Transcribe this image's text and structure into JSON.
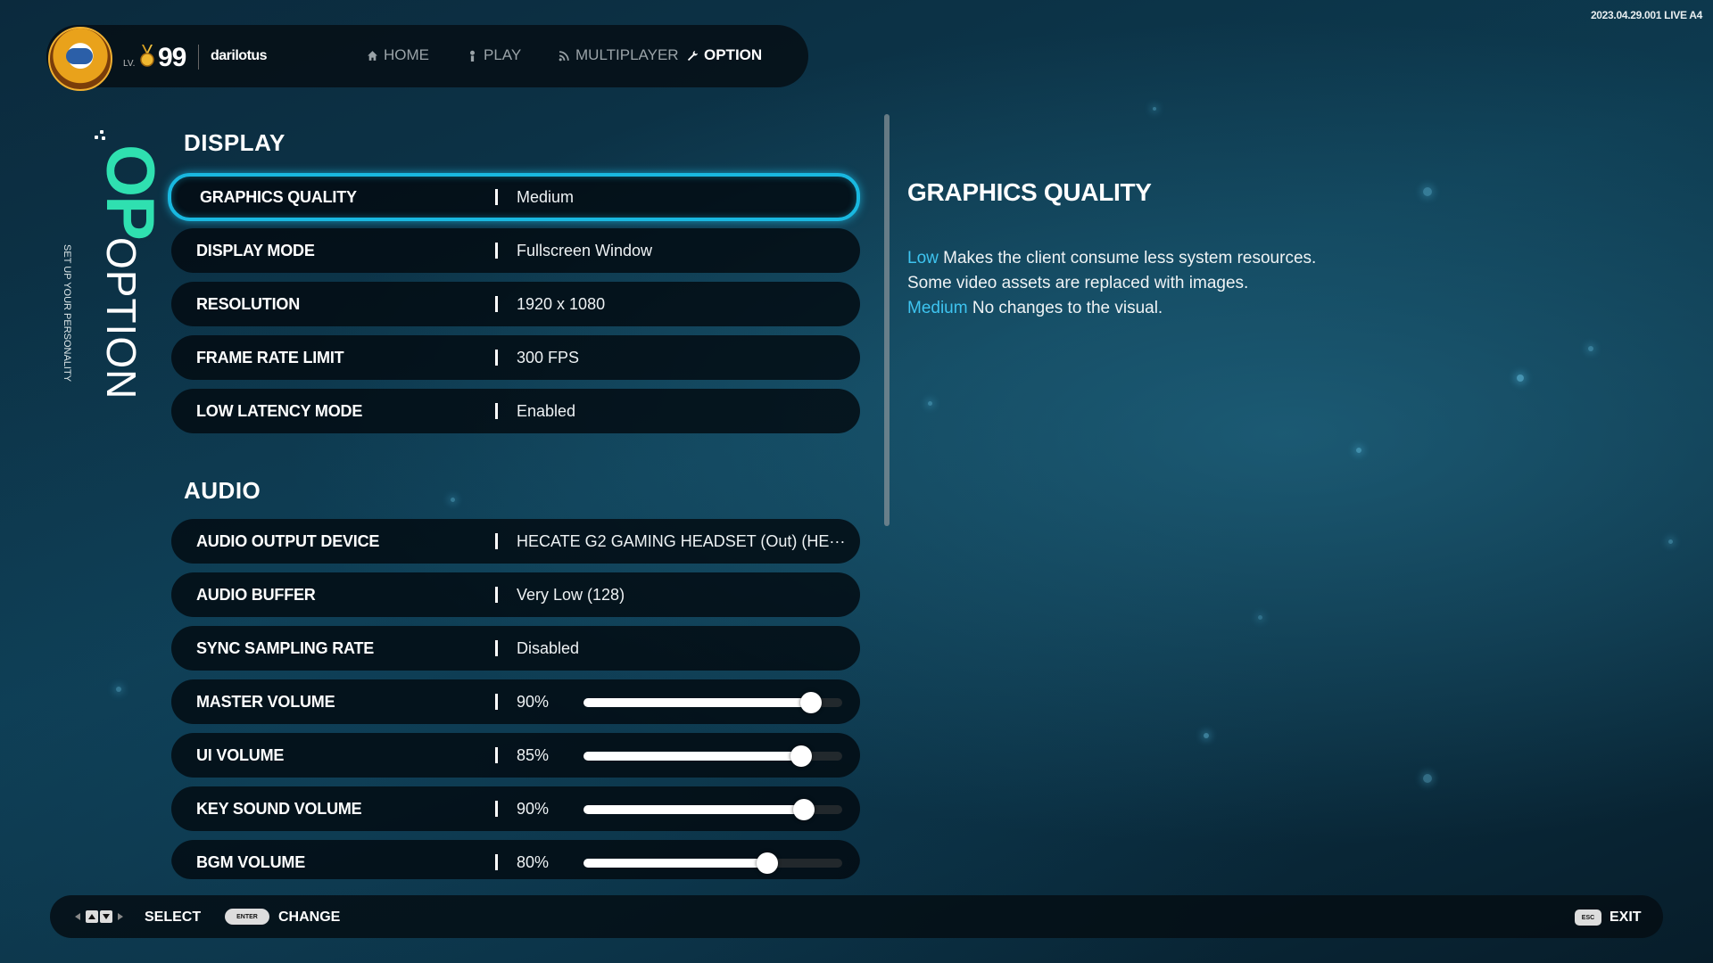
{
  "version": "2023.04.29.001 LIVE A4",
  "player": {
    "lv_label": "LV.",
    "level": "99",
    "username": "darilotus"
  },
  "nav": [
    {
      "label": "HOME",
      "icon": "home-icon"
    },
    {
      "label": "PLAY",
      "icon": "person-icon"
    },
    {
      "label": "MULTIPLAYER",
      "icon": "signal-icon"
    },
    {
      "label": "OPTION",
      "icon": "wrench-icon"
    }
  ],
  "nav_active": "OPTION",
  "side": {
    "big": "OP",
    "title": "OPTION",
    "subtitle": "SET UP YOUR PERSONALITY"
  },
  "display": {
    "title": "DISPLAY",
    "rows": [
      {
        "label": "GRAPHICS QUALITY",
        "value": "Medium"
      },
      {
        "label": "DISPLAY MODE",
        "value": "Fullscreen Window"
      },
      {
        "label": "RESOLUTION",
        "value": "1920 x 1080"
      },
      {
        "label": "FRAME RATE LIMIT",
        "value": "300 FPS"
      },
      {
        "label": "LOW LATENCY MODE",
        "value": "Enabled"
      }
    ]
  },
  "audio": {
    "title": "AUDIO",
    "rows": [
      {
        "label": "AUDIO OUTPUT DEVICE",
        "value": "HECATE G2 GAMING HEADSET (Out) (HE···"
      },
      {
        "label": "AUDIO BUFFER",
        "value": "Very Low (128)"
      },
      {
        "label": "SYNC SAMPLING RATE",
        "value": "Disabled"
      }
    ],
    "sliders": [
      {
        "label": "MASTER VOLUME",
        "value": "90%",
        "level": 0.88
      },
      {
        "label": "UI VOLUME",
        "value": "85%",
        "level": 0.84
      },
      {
        "label": "KEY SOUND VOLUME",
        "value": "90%",
        "level": 0.85
      },
      {
        "label": "BGM VOLUME",
        "value": "80%",
        "level": 0.71
      }
    ]
  },
  "detail": {
    "title": "GRAPHICS QUALITY",
    "low_keyword": "Low",
    "low_text": " Makes the client consume less system resources.",
    "low_text2": "Some video assets are replaced with images.",
    "medium_keyword": "Medium",
    "medium_text": " No changes to the visual."
  },
  "footer": {
    "select": "SELECT",
    "enter_key": "ENTER",
    "change": "CHANGE",
    "esc_key": "ESC",
    "exit": "EXIT"
  },
  "colors": {
    "accent": "#19b8e0",
    "highlight": "#3ec4f0",
    "op_green": "#2fe0b0"
  }
}
